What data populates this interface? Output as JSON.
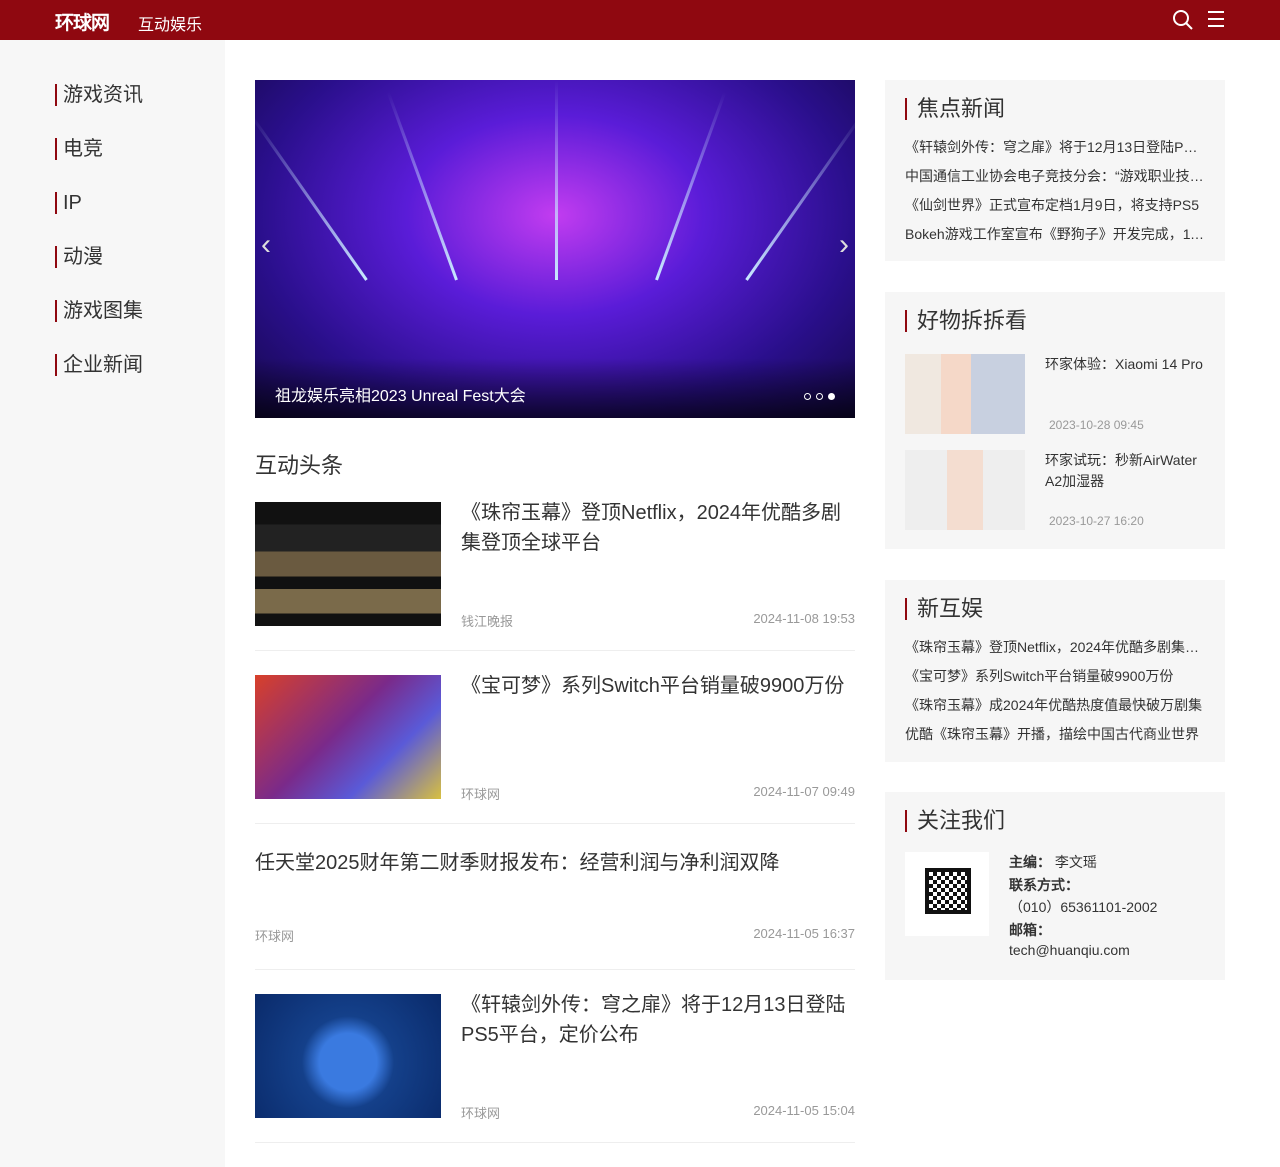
{
  "header": {
    "logo": "环球网",
    "channel": "互动娱乐"
  },
  "sidebar": {
    "items": [
      "游戏资讯",
      "电竞",
      "IP",
      "动漫",
      "游戏图集",
      "企业新闻"
    ]
  },
  "carousel": {
    "caption": "祖龙娱乐亮相2023 Unreal Fest大会",
    "slides": 3,
    "active": 3
  },
  "headlines": {
    "title": "互动头条",
    "items": [
      {
        "title": "《珠帘玉幕》登顶Netflix，2024年优酷多剧集登顶全球平台",
        "source": "钱江晚报",
        "time": "2024-11-08 19:53"
      },
      {
        "title": "《宝可梦》系列Switch平台销量破9900万份",
        "source": "环球网",
        "time": "2024-11-07 09:49"
      },
      {
        "title": "任天堂2025财年第二财季财报发布：经营利润与净利润双降",
        "source": "环球网",
        "time": "2024-11-05 16:37"
      },
      {
        "title": "《轩辕剑外传：穹之扉》将于12月13日登陆PS5平台，定价公布",
        "source": "环球网",
        "time": "2024-11-05 15:04"
      }
    ]
  },
  "focus": {
    "title": "焦点新闻",
    "items": [
      "《轩辕剑外传：穹之扉》将于12月13日登陆PS5平台，定价公布",
      "中国通信工业协会电子竞技分会：“游戏职业技能”",
      "《仙剑世界》正式宣布定档1月9日，将支持PS5",
      "Bokeh游戏工作室宣布《野狗子》开发完成，11月发售"
    ]
  },
  "goods": {
    "title": "好物拆拆看",
    "items": [
      {
        "title": "环家体验：Xiaomi 14 Pro",
        "time": "2023-10-28 09:45"
      },
      {
        "title": "环家试玩：秒新AirWater A2加湿器",
        "time": "2023-10-27 16:20"
      }
    ]
  },
  "newent": {
    "title": "新互娱",
    "items": [
      "《珠帘玉幕》登顶Netflix，2024年优酷多剧集登顶全球平台",
      "《宝可梦》系列Switch平台销量破9900万份",
      "《珠帘玉幕》成2024年优酷热度值最快破万剧集",
      "优酷《珠帘玉幕》开播，描绘中国古代商业世界"
    ]
  },
  "follow": {
    "title": "关注我们",
    "editor_label": "主编：",
    "editor": "李文瑶",
    "contact_label": "联系方式：",
    "phone": "（010）65361101-2002",
    "email_label": "邮箱：",
    "email": "tech@huanqiu.com"
  }
}
